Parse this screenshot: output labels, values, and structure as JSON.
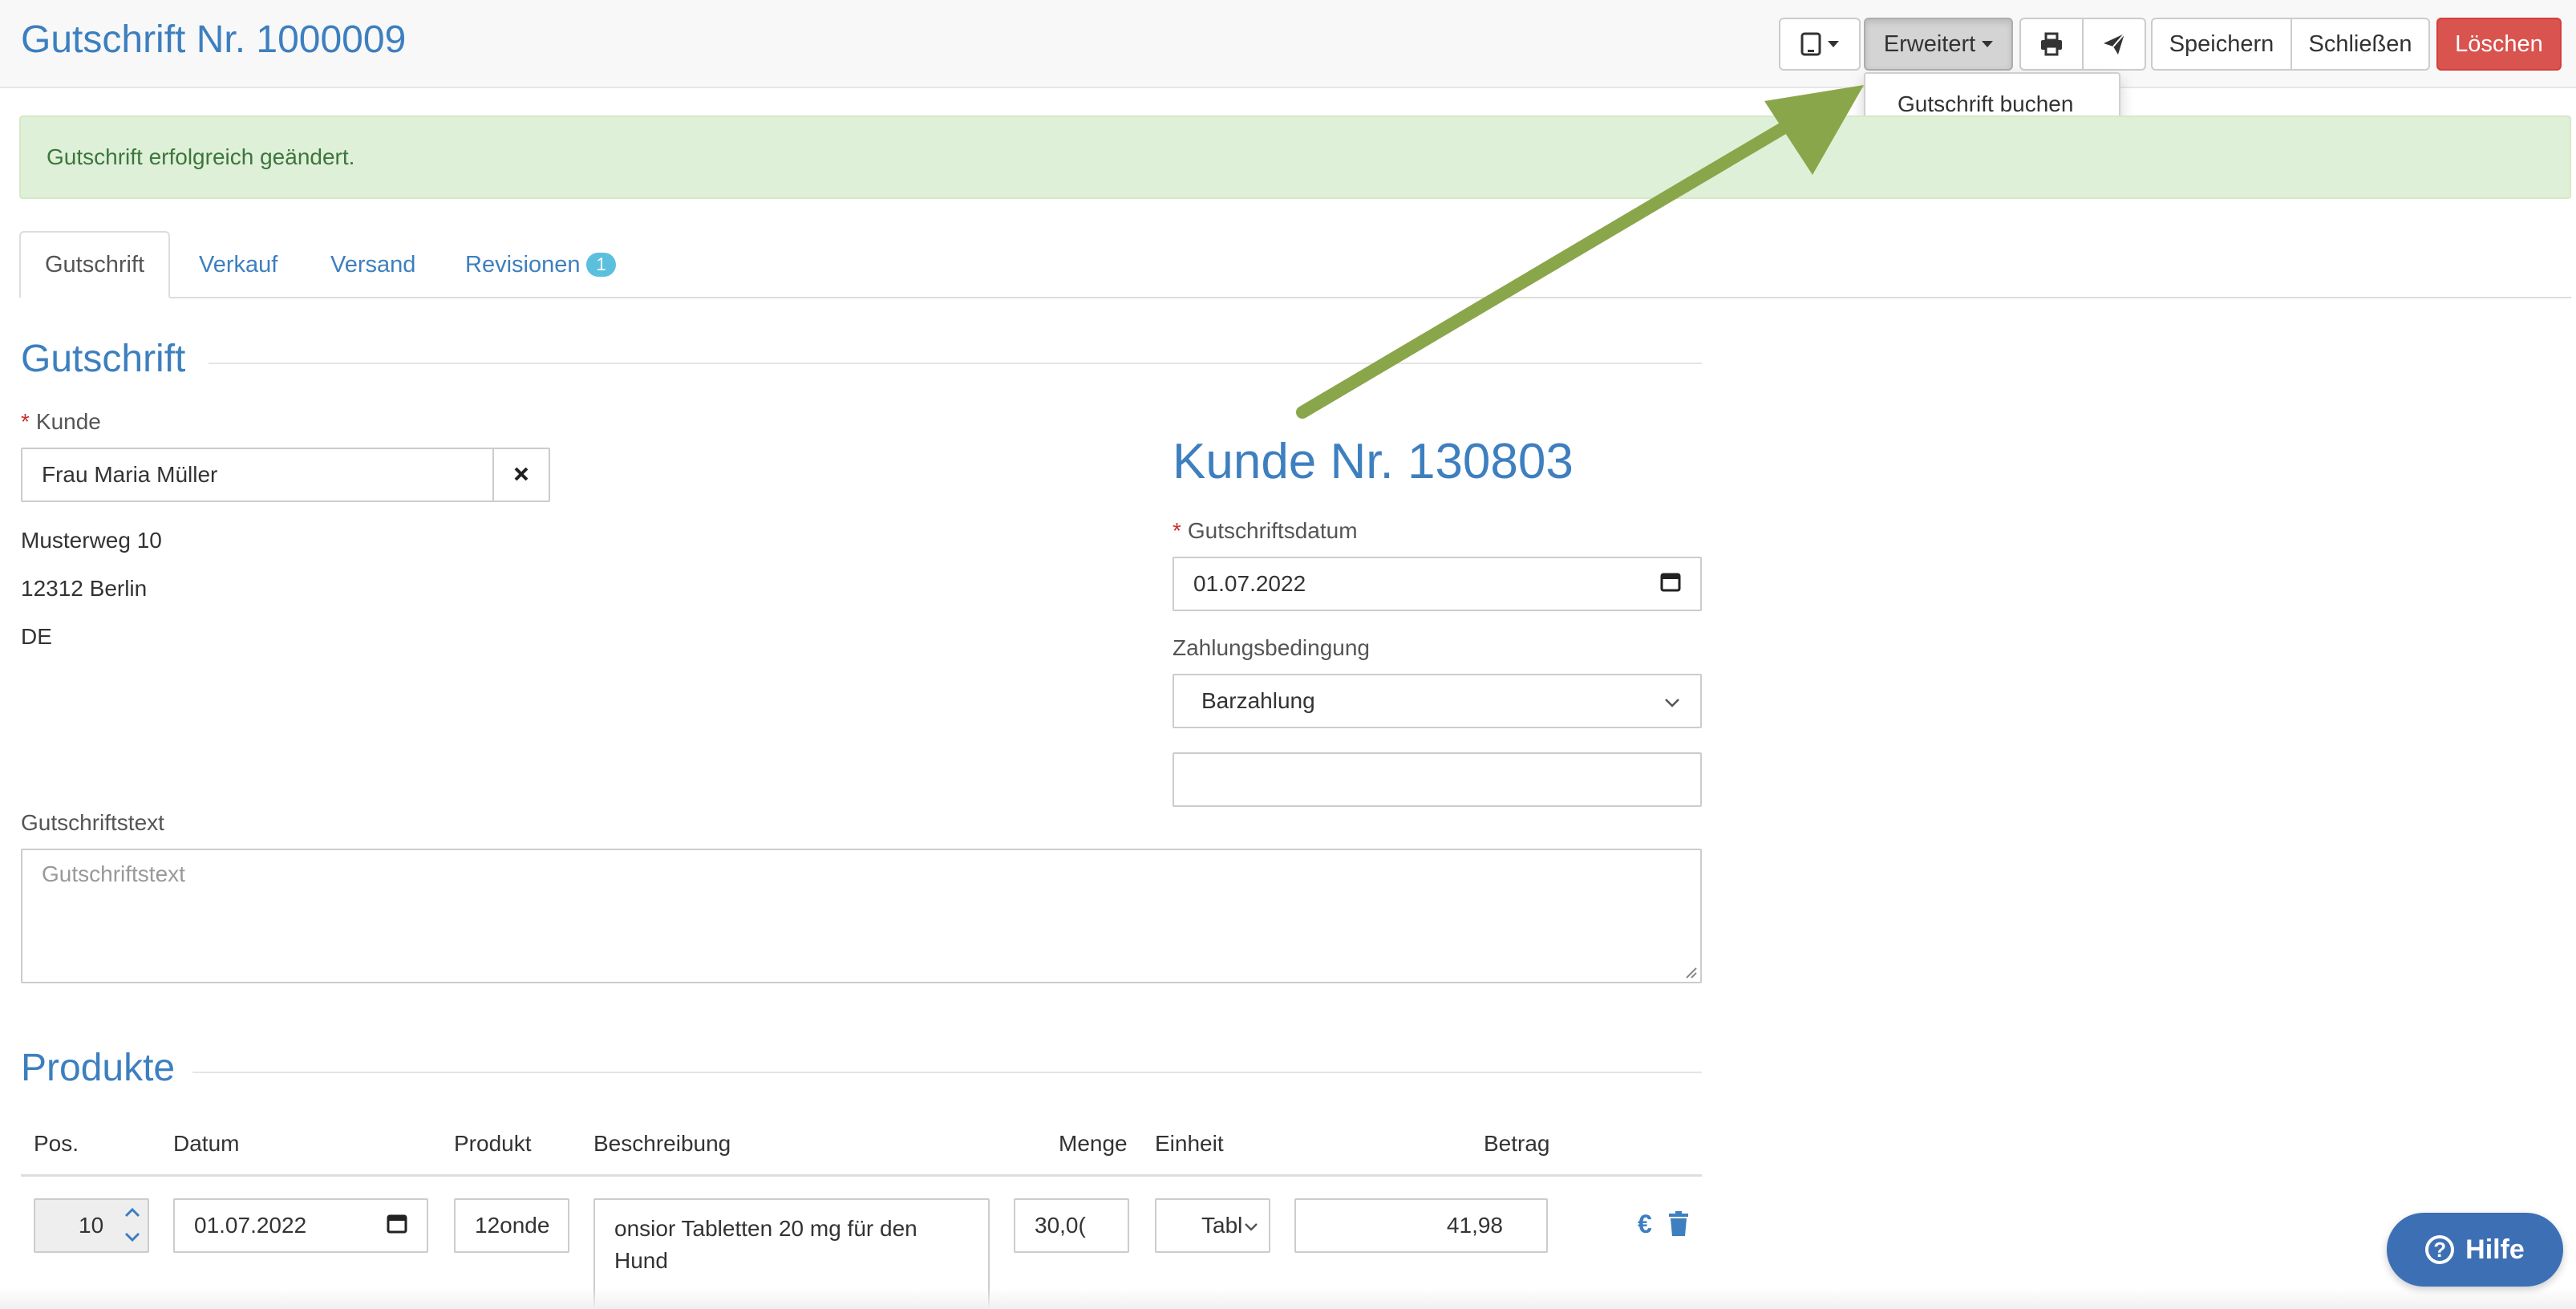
{
  "header": {
    "title": "Gutschrift Nr. 1000009",
    "erweitert_label": "Erweitert",
    "save_label": "Speichern",
    "close_label": "Schließen",
    "delete_label": "Löschen",
    "dropdown_item": "Gutschrift buchen"
  },
  "alert": {
    "message": "Gutschrift erfolgreich geändert."
  },
  "tabs": [
    {
      "label": "Gutschrift",
      "active": true
    },
    {
      "label": "Verkauf"
    },
    {
      "label": "Versand"
    },
    {
      "label": "Revisionen",
      "badge": "1"
    }
  ],
  "form": {
    "section_title": "Gutschrift",
    "kunde_label": "Kunde",
    "kunde_value": "Frau Maria Müller",
    "address": [
      "Musterweg 10",
      "12312 Berlin",
      "DE"
    ],
    "kunde_nr": "Kunde Nr. 130803",
    "datum_label": "Gutschriftsdatum",
    "datum_value": "01.07.2022",
    "zahlung_label": "Zahlungsbedingung",
    "zahlung_value": "Barzahlung",
    "extra_value": "",
    "text_label": "Gutschriftstext",
    "text_placeholder": "Gutschriftstext"
  },
  "products": {
    "section_title": "Produkte",
    "columns": [
      "Pos.",
      "Datum",
      "Produkt",
      "Beschreibung",
      "Menge",
      "Einheit",
      "Betrag"
    ],
    "rows": [
      {
        "pos": "10",
        "datum": "01.07.2022",
        "produkt": "12onde",
        "beschreibung": "onsior Tabletten 20 mg für den Hund",
        "menge": "30,0(",
        "einheit": "Tabl",
        "betrag": "41,98"
      }
    ]
  },
  "help": {
    "label": "Hilfe"
  },
  "colors": {
    "brand_blue": "#3d7fbf",
    "danger": "#d9534f",
    "success_bg": "#dff0d8",
    "arrow": "#8aa64a"
  }
}
